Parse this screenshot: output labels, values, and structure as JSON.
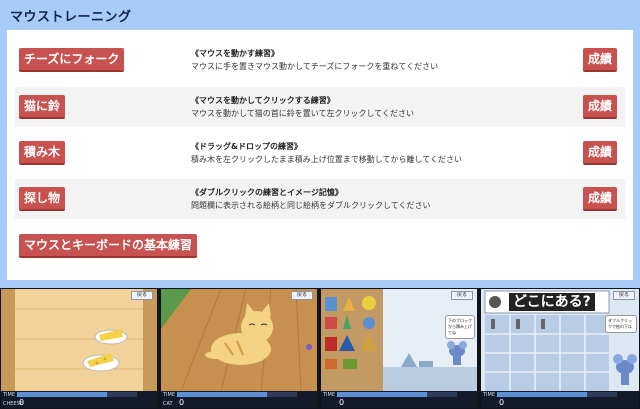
{
  "app": {
    "title": "マウストレーニング"
  },
  "lessons": [
    {
      "button": "チーズにフォーク",
      "title": "《マウスを動かす練習》",
      "description": "マウスに手を置きマウス動かしてチーズにフォークを重ねてください",
      "score_label": "成績"
    },
    {
      "button": "猫に鈴",
      "title": "《マウスを動かしてクリックする練習》",
      "description": "マウスを動かして猫の首に鈴を置いて左クリックしてください",
      "score_label": "成績"
    },
    {
      "button": "積み木",
      "title": "《ドラッグ&ドロップの練習》",
      "description": "積み木を左クリックしたまま積み上げ位置まで移動してから離してください",
      "score_label": "成績"
    },
    {
      "button": "探し物",
      "title": "《ダブルクリックの練習とイメージ記憶》",
      "description": "問題欄に表示される絵柄と同じ絵柄をダブルクリックしてください",
      "score_label": "成績"
    }
  ],
  "basic_practice_label": "マウスとキーボードの基本練習",
  "screens": [
    {
      "name": "cheese",
      "back_label": "戻る",
      "time_label": "TIME",
      "item_label": "CHEESE",
      "item_value": "0",
      "time_remaining": 0.75
    },
    {
      "name": "cat",
      "back_label": "戻る",
      "time_label": "TIME",
      "item_label": "CAT",
      "item_value": "0",
      "time_remaining": 0.75
    },
    {
      "name": "blocks",
      "back_label": "戻る",
      "time_label": "TIME",
      "item_label": "",
      "item_value": "0",
      "speech": "下のブロックから積み上げてね",
      "time_remaining": 0.75
    },
    {
      "name": "search",
      "back_label": "戻る",
      "time_label": "TIME",
      "item_label": "",
      "item_value": "0",
      "question": "どこにある?",
      "speech": "ダブルクリックで絵の下は",
      "time_remaining": 0.75
    }
  ],
  "colors": {
    "header_bg": "#a8ccf7",
    "button_red": "#c8524f",
    "strip_bg": "#10131c",
    "time_fill": "#5c8fd6"
  }
}
